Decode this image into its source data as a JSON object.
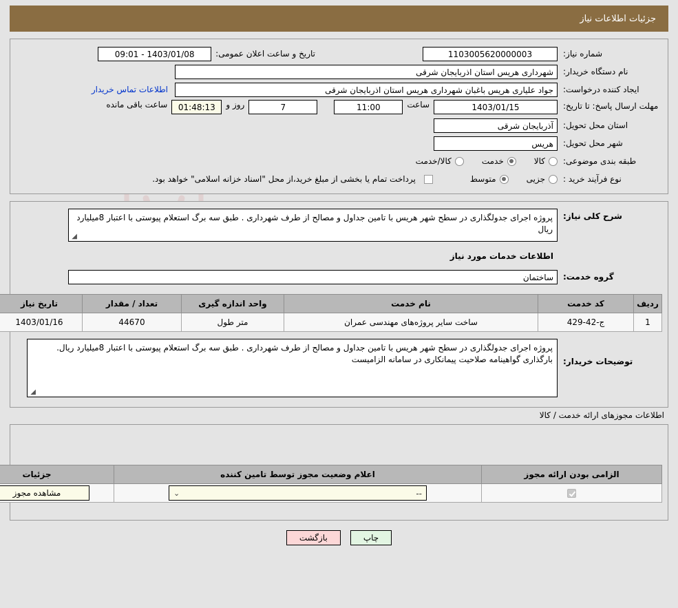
{
  "header": {
    "title": "جزئیات اطلاعات نیاز",
    "bar_color": "#8a6d42"
  },
  "watermark": {
    "text": "AriaTender.net"
  },
  "info": {
    "need_number_label": "شماره نیاز:",
    "need_number_value": "1103005620000003",
    "public_announce_label": "تاریخ و ساعت اعلان عمومی:",
    "public_announce_value": "1403/01/08 - 09:01",
    "buyer_org_label": "نام دستگاه خریدار:",
    "buyer_org_value": "شهرداری هریس استان اذربایجان شرقی",
    "requester_label": "ایجاد کننده درخواست:",
    "requester_value": "جواد علیاری هریس باغبان شهرداری هریس استان اذربایجان شرقی",
    "contact_link": "اطلاعات تماس خریدار",
    "deadline_label": "مهلت ارسال پاسخ: تا تاریخ:",
    "deadline_date": "1403/01/15",
    "hour_label": "ساعت",
    "deadline_time": "11:00",
    "remaining_days": "7",
    "days_and_label": "روز و",
    "remaining_time": "01:48:13",
    "remaining_suffix": "ساعت باقی مانده",
    "province_label": "استان محل تحویل:",
    "province_value": "آذربایجان شرقی",
    "city_label": "شهر محل تحویل:",
    "city_value": "هریس",
    "category_label": "طبقه بندی موضوعی:",
    "category_options": [
      {
        "label": "کالا",
        "selected": false
      },
      {
        "label": "خدمت",
        "selected": true
      },
      {
        "label": "کالا/خدمت",
        "selected": false
      }
    ],
    "process_label": "نوع فرآیند خرید :",
    "process_options": [
      {
        "label": "جزیی",
        "selected": false
      },
      {
        "label": "متوسط",
        "selected": true
      }
    ],
    "treasury_checkbox_checked": false,
    "treasury_note": "پرداخت تمام یا بخشی از مبلغ خرید،از محل \"اسناد خزانه اسلامی\" خواهد بود."
  },
  "description": {
    "label": "شرح کلی نیاز:",
    "value": "پروژه اجرای جدولگذاری در سطح شهر هریس با تامین جداول و مصالح از طرف شهرداری . طبق سه برگ استعلام پیوستی با اعتبار 8میلیارد ریال",
    "services_heading": "اطلاعات خدمات مورد نیاز",
    "service_group_label": "گروه خدمت:",
    "service_group_value": "ساختمان"
  },
  "services_table": {
    "columns": [
      "ردیف",
      "کد خدمت",
      "نام خدمت",
      "واحد اندازه گیری",
      "تعداد / مقدار",
      "تاریخ نیاز"
    ],
    "rows": [
      {
        "row": "1",
        "code": "ج-42-429",
        "name": "ساخت سایر پروژه‌های مهندسی عمران",
        "unit": "متر طول",
        "quantity": "44670",
        "date": "1403/01/16"
      }
    ]
  },
  "buyer_notes": {
    "label": "توضیحات خریدار:",
    "value": "پروژه اجرای جدولگذاری در سطح شهر هریس با تامین جداول و مصالح از طرف شهرداری . طبق سه برگ استعلام پیوستی با اعتبار 8میلیارد ریال. بارگذاری گواهینامه صلاحیت پیمانکاری در سامانه الزامیست"
  },
  "permits": {
    "heading": "اطلاعات مجوزهای ارائه خدمت / کالا",
    "columns": [
      "الزامی بودن ارائه مجوز",
      "اعلام وضعیت مجوز توسط تامین کننده",
      "جزئیات"
    ],
    "rows": [
      {
        "required_checked": true,
        "status_value": "--",
        "details_button": "مشاهده مجوز"
      }
    ]
  },
  "footer": {
    "back_button": "بازگشت",
    "print_button": "چاپ"
  }
}
